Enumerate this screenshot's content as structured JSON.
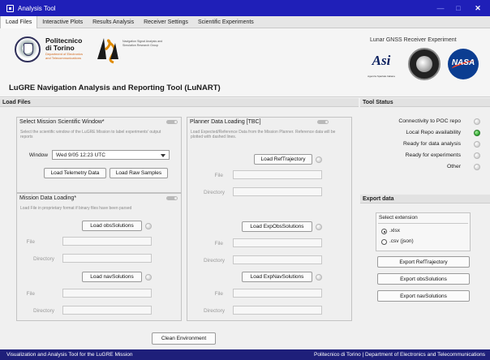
{
  "window": {
    "title": "Analysis Tool"
  },
  "tabs": [
    "Load Files",
    "Interactive Plots",
    "Results Analysis",
    "Receiver Settings",
    "Scientific Experiments"
  ],
  "header": {
    "polito_name_line1": "Politecnico",
    "polito_name_line2": "di Torino",
    "polito_dept": "Department of Electronics and Telecommunications",
    "nas_desc": "Navigation Signal Analysis and Simulation Research Group",
    "app_title": "LuGRE Navigation Analysis and Reporting Tool (LuNART)",
    "experiment_title": "Lunar GNSS Receiver Experiment",
    "asi_text": "Asi",
    "asi_sub": "Agenzia Spaziale Italiana",
    "nasa_text": "NASA"
  },
  "load_files": {
    "heading": "Load Files",
    "mission_window": {
      "title": "Select Mission Scientific Window*",
      "hint": "Select the scientific window of the LuGRE Mission to label experiments' output reports",
      "window_label": "Window",
      "window_value": "Wed 9/05 12:23 UTC",
      "btn_telemetry": "Load Telemetry Data",
      "btn_raw": "Load Raw Samples"
    },
    "mission_data": {
      "title": "Mission Data Loading*",
      "hint": "Load File in proprietary format if binary files have been parsed",
      "btn_obs": "Load obsSolutions",
      "btn_nav": "Load navSolutions",
      "file_label": "File",
      "dir_label": "Directory"
    },
    "planner": {
      "title": "Planner Data Loading [TBC]",
      "hint": "Load Expected/Reference Data from the Mission Planner. Reference data will be plotted with dashed lines.",
      "btn_ref": "Load RefTrajectory",
      "btn_expobs": "Load ExpObsSolutions",
      "btn_expnav": "Load ExpNavSolutions",
      "file_label": "File",
      "dir_label": "Directory"
    },
    "clean_button": "Clean Environment"
  },
  "tool_status": {
    "heading": "Tool Status",
    "items": [
      {
        "label": "Connectivity to POC repo",
        "on": false
      },
      {
        "label": "Local Repo availability",
        "on": true
      },
      {
        "label": "Ready for data analysis",
        "on": false
      },
      {
        "label": "Ready for experiments",
        "on": false
      },
      {
        "label": "Other",
        "on": false
      }
    ]
  },
  "export_data": {
    "heading": "Export data",
    "select_title": "Select extension",
    "opt_xlsx": ".xlsx",
    "opt_csv": ".csv (json)",
    "selected": ".xlsx",
    "btn_ref": "Export RefTrajectory",
    "btn_obs": "Export obsSolutions",
    "btn_nav": "Export navSolutions"
  },
  "statusbar": {
    "left": "Visualization and Analysis Tool for the LuGRE Mission",
    "right": "Politecnico di Torino | Department of Electronics and Telecommunications"
  },
  "colors": {
    "titlebar": "#1f1fb8",
    "statusbar": "#1e1f7a",
    "lamp_on": "#2aa52a"
  }
}
